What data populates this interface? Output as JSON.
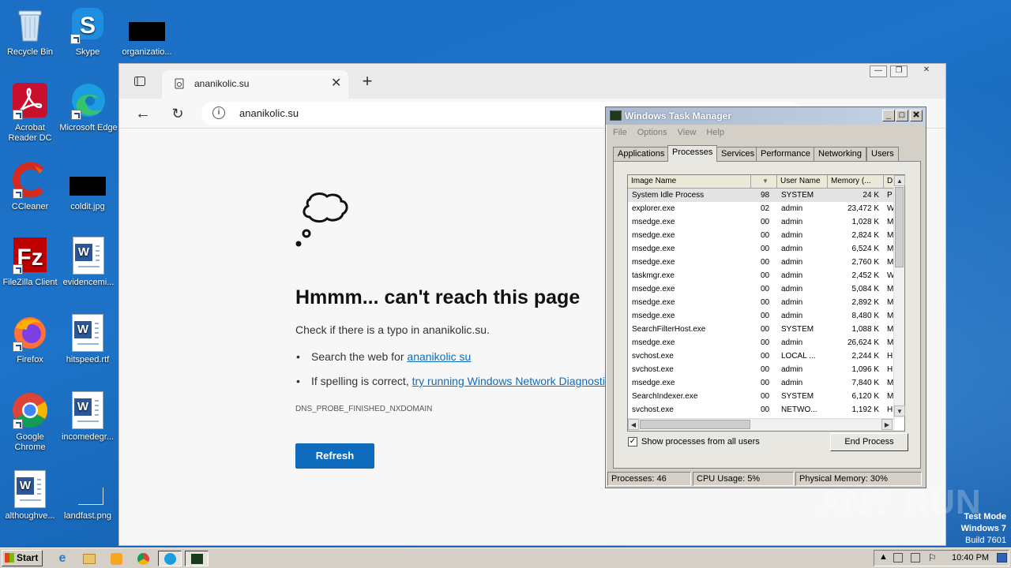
{
  "desktop": {
    "icons": [
      {
        "label": "Recycle Bin",
        "icon": "recycle-bin-icon"
      },
      {
        "label": "Skype",
        "icon": "skype-icon"
      },
      {
        "label": "organizatio...",
        "icon": "black-file-icon"
      },
      {
        "label": "Acrobat Reader DC",
        "icon": "acrobat-icon"
      },
      {
        "label": "Microsoft Edge",
        "icon": "edge-icon"
      },
      {
        "label": "CCleaner",
        "icon": "ccleaner-icon"
      },
      {
        "label": "coldit.jpg",
        "icon": "black-file-icon"
      },
      {
        "label": "FileZilla Client",
        "icon": "filezilla-icon"
      },
      {
        "label": "evidencemi...",
        "icon": "word-doc-icon"
      },
      {
        "label": "Firefox",
        "icon": "firefox-icon"
      },
      {
        "label": "hitspeed.rtf",
        "icon": "word-doc-icon"
      },
      {
        "label": "Google Chrome",
        "icon": "chrome-icon"
      },
      {
        "label": "incomedegr...",
        "icon": "word-doc-icon"
      },
      {
        "label": "althoughve...",
        "icon": "word-doc-icon"
      },
      {
        "label": "landfast.png",
        "icon": "image-file-icon"
      }
    ],
    "watermark": "ANY RUN",
    "test_mode": [
      "Test Mode",
      "Windows 7",
      "Build 7601"
    ]
  },
  "browser": {
    "tab_title": "ananikolic.su",
    "url": "ananikolic.su",
    "error": {
      "heading": "Hmmm... can't reach this page",
      "check_text": "Check if there is a typo in ananikolic.su.",
      "bullet1_prefix": "Search the web for ",
      "bullet1_link": "ananikolic su",
      "bullet2_prefix": "If spelling is correct, ",
      "bullet2_link": "try running Windows Network Diagnostic",
      "code": "DNS_PROBE_FINISHED_NXDOMAIN",
      "refresh_label": "Refresh"
    },
    "accent_color": "#0f6cbd"
  },
  "task_manager": {
    "title": "Windows Task Manager",
    "menu": [
      "File",
      "Options",
      "View",
      "Help"
    ],
    "tabs": [
      "Applications",
      "Processes",
      "Services",
      "Performance",
      "Networking",
      "Users"
    ],
    "active_tab": "Processes",
    "columns": [
      "Image Name",
      "User Name",
      "Memory (...",
      "D"
    ],
    "processes": [
      {
        "name": "System Idle Process",
        "cpu": "98",
        "user": "SYSTEM",
        "mem": "24 K",
        "d": "P"
      },
      {
        "name": "explorer.exe",
        "cpu": "02",
        "user": "admin",
        "mem": "23,472 K",
        "d": "W"
      },
      {
        "name": "msedge.exe",
        "cpu": "00",
        "user": "admin",
        "mem": "1,028 K",
        "d": "M"
      },
      {
        "name": "msedge.exe",
        "cpu": "00",
        "user": "admin",
        "mem": "2,824 K",
        "d": "M"
      },
      {
        "name": "msedge.exe",
        "cpu": "00",
        "user": "admin",
        "mem": "6,524 K",
        "d": "M"
      },
      {
        "name": "msedge.exe",
        "cpu": "00",
        "user": "admin",
        "mem": "2,760 K",
        "d": "M"
      },
      {
        "name": "taskmgr.exe",
        "cpu": "00",
        "user": "admin",
        "mem": "2,452 K",
        "d": "W"
      },
      {
        "name": "msedge.exe",
        "cpu": "00",
        "user": "admin",
        "mem": "5,084 K",
        "d": "M"
      },
      {
        "name": "msedge.exe",
        "cpu": "00",
        "user": "admin",
        "mem": "2,892 K",
        "d": "M"
      },
      {
        "name": "msedge.exe",
        "cpu": "00",
        "user": "admin",
        "mem": "8,480 K",
        "d": "M"
      },
      {
        "name": "SearchFilterHost.exe",
        "cpu": "00",
        "user": "SYSTEM",
        "mem": "1,088 K",
        "d": "M"
      },
      {
        "name": "msedge.exe",
        "cpu": "00",
        "user": "admin",
        "mem": "26,624 K",
        "d": "M"
      },
      {
        "name": "svchost.exe",
        "cpu": "00",
        "user": "LOCAL ...",
        "mem": "2,244 K",
        "d": "H"
      },
      {
        "name": "svchost.exe",
        "cpu": "00",
        "user": "admin",
        "mem": "1,096 K",
        "d": "H"
      },
      {
        "name": "msedge.exe",
        "cpu": "00",
        "user": "admin",
        "mem": "7,840 K",
        "d": "M"
      },
      {
        "name": "SearchIndexer.exe",
        "cpu": "00",
        "user": "SYSTEM",
        "mem": "6,120 K",
        "d": "M"
      },
      {
        "name": "svchost.exe",
        "cpu": "00",
        "user": "NETWO...",
        "mem": "1,192 K",
        "d": "H"
      }
    ],
    "show_all_label": "Show processes from all users",
    "show_all_checked": true,
    "end_process_label": "End Process",
    "status": {
      "processes": "Processes: 46",
      "cpu": "CPU Usage: 5%",
      "memory": "Physical Memory: 30%"
    }
  },
  "taskbar": {
    "start_label": "Start",
    "apps": [
      "ie-icon",
      "explorer-icon",
      "media-player-icon",
      "chrome-icon",
      "edge-icon",
      "task-manager-icon"
    ],
    "time": "10:40 PM"
  }
}
